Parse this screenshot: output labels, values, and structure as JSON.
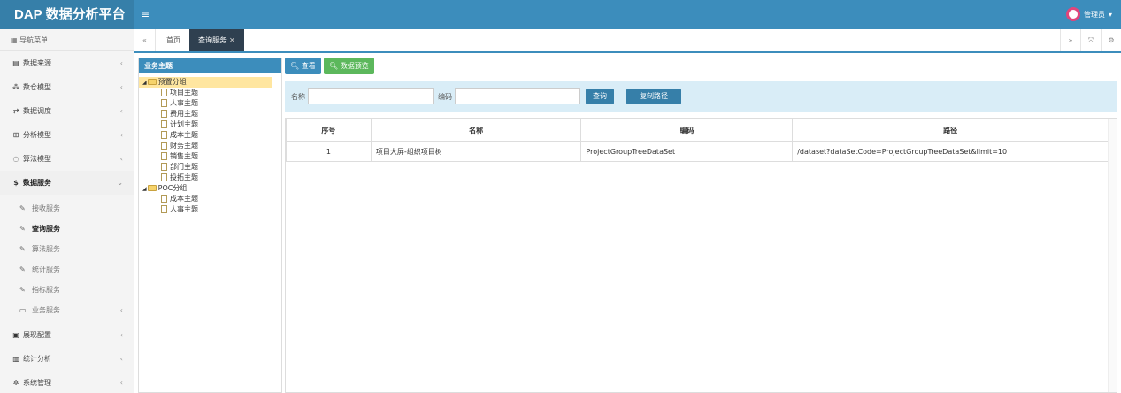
{
  "app": {
    "title": "DAP 数据分析平台",
    "user": "管理员"
  },
  "sidebar": {
    "header": "导航菜单",
    "items": [
      {
        "label": "数据来源"
      },
      {
        "label": "数仓模型"
      },
      {
        "label": "数据调度"
      },
      {
        "label": "分析模型"
      },
      {
        "label": "算法模型"
      },
      {
        "label": "数据服务"
      }
    ],
    "subitems": [
      {
        "label": "接收服务"
      },
      {
        "label": "查询服务"
      },
      {
        "label": "算法服务"
      },
      {
        "label": "统计服务"
      },
      {
        "label": "指标服务"
      },
      {
        "label": "业务服务"
      }
    ],
    "bottom_items": [
      {
        "label": "展现配置"
      },
      {
        "label": "统计分析"
      },
      {
        "label": "系统管理"
      }
    ]
  },
  "tabs": [
    {
      "label": "首页"
    },
    {
      "label": "查询服务"
    }
  ],
  "tree": {
    "header": "业务主题",
    "groups": [
      {
        "label": "预置分组",
        "children": [
          "项目主题",
          "人事主题",
          "费用主题",
          "计划主题",
          "成本主题",
          "财务主题",
          "销售主题",
          "部门主题",
          "投拓主题"
        ]
      },
      {
        "label": "POC分组",
        "children": [
          "成本主题",
          "人事主题"
        ]
      }
    ]
  },
  "toolbar": {
    "view_label": "查看",
    "preview_label": "数据预览"
  },
  "search": {
    "name_label": "名称",
    "name_value": "",
    "code_label": "编码",
    "code_value": "",
    "query_label": "查询",
    "copy_label": "复制路径"
  },
  "table": {
    "headers": [
      "序号",
      "名称",
      "编码",
      "路径"
    ],
    "rows": [
      [
        "1",
        "项目大屏-组织项目树",
        "ProjectGroupTreeDataSet",
        "/dataset?dataSetCode=ProjectGroupTreeDataSet&limit=10"
      ]
    ]
  }
}
